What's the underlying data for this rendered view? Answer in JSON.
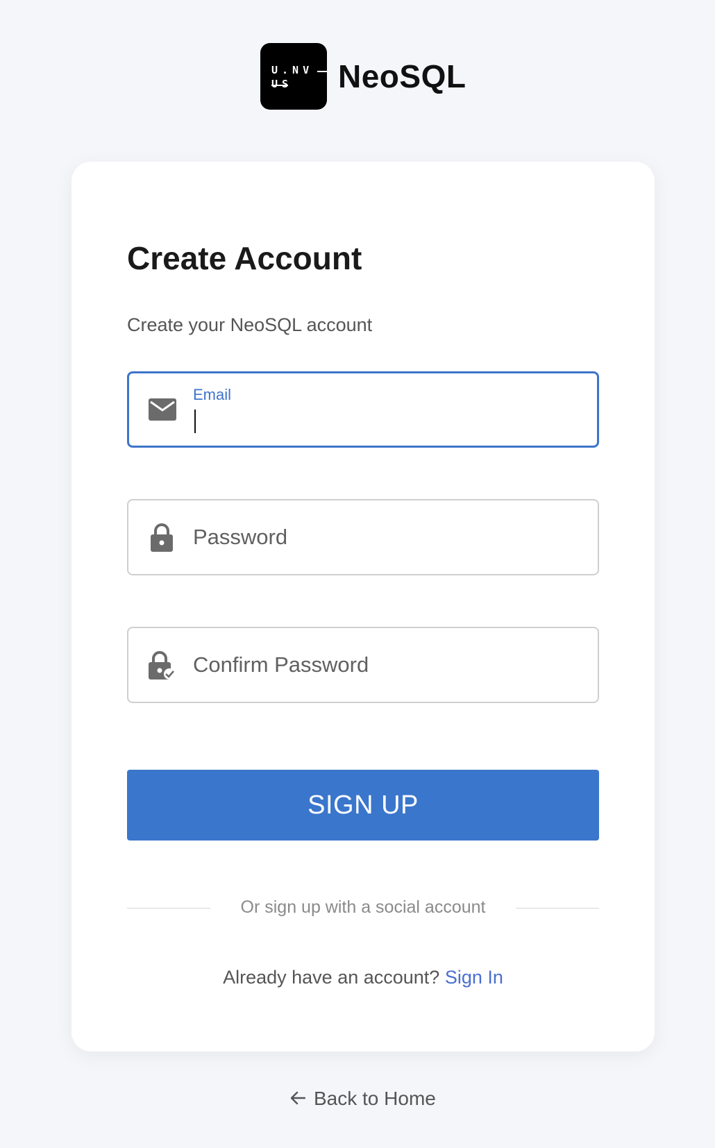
{
  "brand": {
    "logo_line1": "U.NV",
    "logo_line2": "US",
    "name": "NeoSQL"
  },
  "form": {
    "title": "Create Account",
    "subtitle": "Create your NeoSQL account",
    "email": {
      "label": "Email",
      "value": "",
      "icon": "mail-icon",
      "state": "focused"
    },
    "password": {
      "placeholder": "Password",
      "value": "",
      "icon": "lock-icon"
    },
    "confirm_password": {
      "placeholder": "Confirm Password",
      "value": "",
      "icon": "lock-check-icon"
    },
    "submit_label": "SIGN UP",
    "divider_text": "Or sign up with a social account",
    "signin_prompt": "Already have an account?",
    "signin_link": "Sign In"
  },
  "footer": {
    "back_label": "Back to Home",
    "back_icon": "arrow-left-icon"
  },
  "colors": {
    "page_bg": "#f5f6fa",
    "accent": "#3a76cc",
    "link": "#4a6fd1",
    "focus_border": "#3d74c9"
  }
}
